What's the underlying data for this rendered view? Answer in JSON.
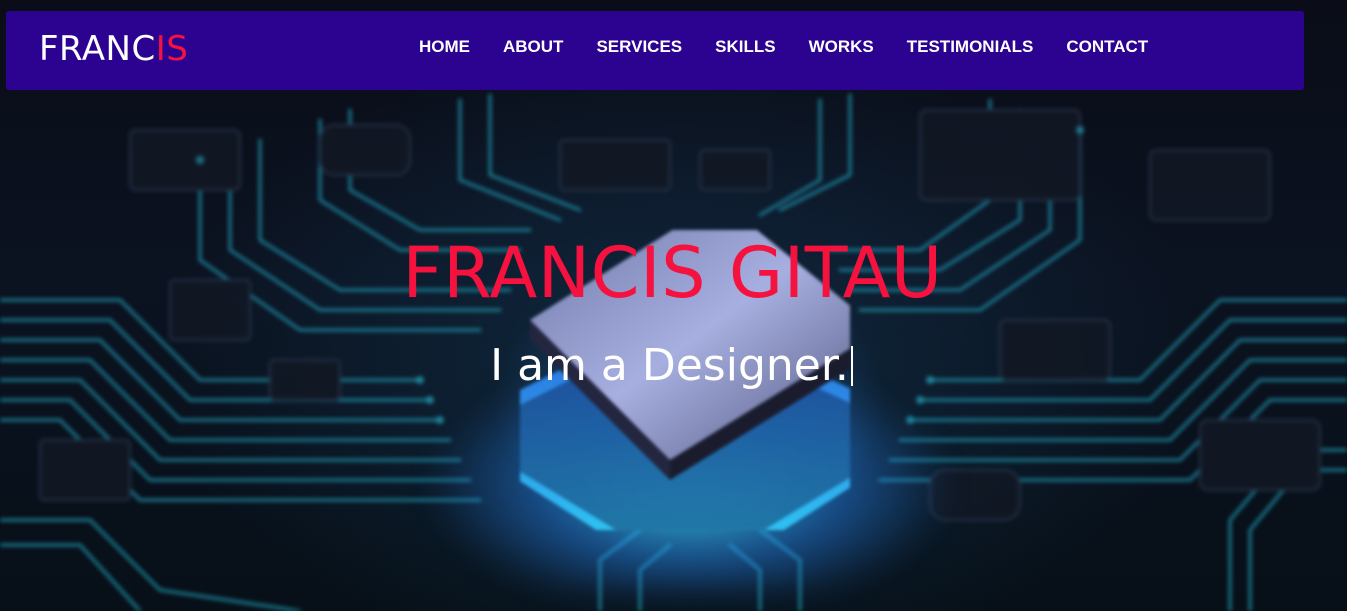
{
  "brand": {
    "logo_prefix": "FRANC",
    "logo_suffix": "IS",
    "accent_color": "#f5123f",
    "nav_bg_color": "#2c0390"
  },
  "nav": {
    "items": [
      {
        "label": "HOME"
      },
      {
        "label": "ABOUT"
      },
      {
        "label": "SERVICES"
      },
      {
        "label": "SKILLS"
      },
      {
        "label": "WORKS"
      },
      {
        "label": "TESTIMONIALS"
      },
      {
        "label": "CONTACT"
      }
    ]
  },
  "hero": {
    "name": "FRANCIS GITAU",
    "typed_text": "I am a Designer.",
    "background": "circuit-board-chip-image"
  }
}
